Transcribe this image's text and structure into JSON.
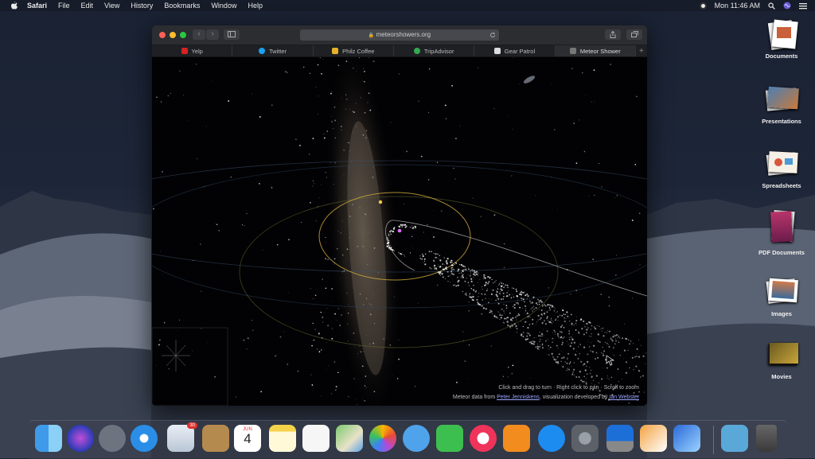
{
  "menubar": {
    "app": "Safari",
    "items": [
      "File",
      "Edit",
      "View",
      "History",
      "Bookmarks",
      "Window",
      "Help"
    ],
    "clock": "Mon 11:46 AM"
  },
  "browser": {
    "url": "meteorshowers.org",
    "tabs": [
      {
        "label": "Yelp",
        "color": "#d32323"
      },
      {
        "label": "Twitter",
        "color": "#1da1f2"
      },
      {
        "label": "Philz Coffee",
        "color": "#e6b22c"
      },
      {
        "label": "TripAdvisor",
        "color": "#34a853"
      },
      {
        "label": "Gear Patrol",
        "color": "#dddddd"
      },
      {
        "label": "Meteor Shower",
        "color": "#777777",
        "active": true
      }
    ],
    "hint": "Click and drag to turn · Right click to pan · Scroll to zoom",
    "credit": {
      "prefix": "Meteor data from ",
      "author1": "Peter Jenniskens",
      "middle": ", visualization developed by ",
      "author2": "Ian Webster"
    }
  },
  "desktop": [
    {
      "label": "Documents"
    },
    {
      "label": "Presentations"
    },
    {
      "label": "Spreadsheets"
    },
    {
      "label": "PDF Documents"
    },
    {
      "label": "Images"
    },
    {
      "label": "Movies"
    }
  ],
  "dock": {
    "mail_badge": "30",
    "calendar_month": "JUN",
    "calendar_day": "4"
  }
}
